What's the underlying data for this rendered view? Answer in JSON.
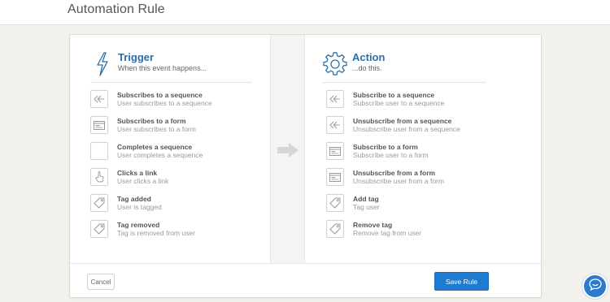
{
  "page": {
    "title": "Automation Rule"
  },
  "trigger": {
    "title": "Trigger",
    "subtitle": "When this event happens...",
    "icon": "lightning-icon",
    "items": [
      {
        "title": "Subscribes to a sequence",
        "desc": "User subscribes to a sequence",
        "icon": "reply-arrows-icon"
      },
      {
        "title": "Subscribes to a form",
        "desc": "User subscribes to a form",
        "icon": "form-icon"
      },
      {
        "title": "Completes a sequence",
        "desc": "User completes a sequence",
        "icon": "blank-icon"
      },
      {
        "title": "Clicks a link",
        "desc": "User clicks a link",
        "icon": "pointer-hand-icon"
      },
      {
        "title": "Tag added",
        "desc": "User is tagged",
        "icon": "tag-icon"
      },
      {
        "title": "Tag removed",
        "desc": "Tag is removed from user",
        "icon": "tag-icon"
      }
    ]
  },
  "action": {
    "title": "Action",
    "subtitle": "...do this.",
    "icon": "gear-icon",
    "items": [
      {
        "title": "Subscribe to a sequence",
        "desc": "Subscribe user to a sequence",
        "icon": "reply-arrows-icon"
      },
      {
        "title": "Unsubscribe from a sequence",
        "desc": "Unsubscribe user from a sequence",
        "icon": "reply-arrows-icon"
      },
      {
        "title": "Subscribe to a form",
        "desc": "Subscribe user to a form",
        "icon": "form-icon"
      },
      {
        "title": "Unsubscribe from a form",
        "desc": "Unsubscribe user from a form",
        "icon": "form-icon"
      },
      {
        "title": "Add tag",
        "desc": "Tag user",
        "icon": "tag-icon"
      },
      {
        "title": "Remove tag",
        "desc": "Remove tag from user",
        "icon": "tag-icon"
      }
    ]
  },
  "footer": {
    "cancel_label": "Cancel",
    "save_label": "Save Rule"
  },
  "colors": {
    "accent": "#2b6ea5",
    "primary_button": "#1f7bd0",
    "background": "#f3f1ec"
  }
}
